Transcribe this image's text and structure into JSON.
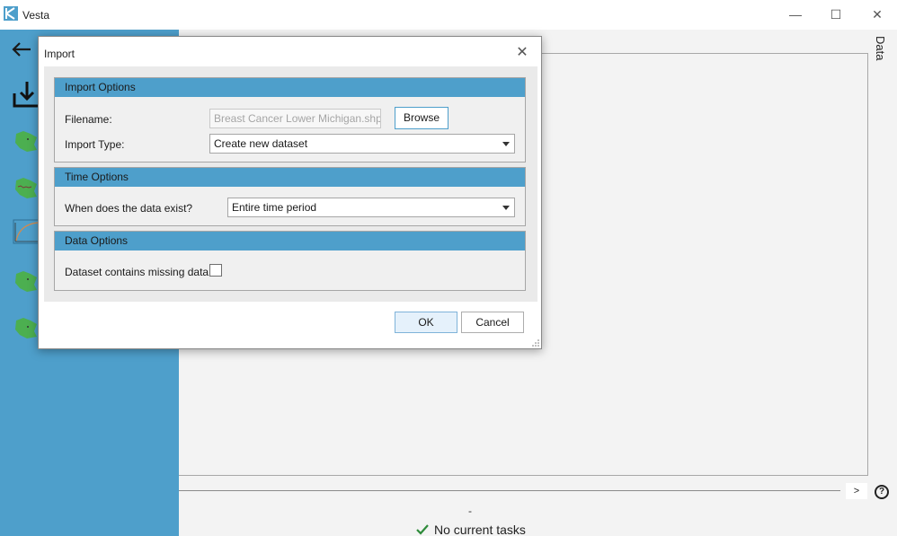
{
  "window": {
    "title": "Vesta",
    "icon": "vesta-logo-icon",
    "controls": {
      "minimize": "—",
      "maximize": "☐",
      "close": "✕"
    }
  },
  "sidebar": {
    "back_icon": "back-arrow-icon",
    "import_icon": "import-download-icon",
    "items": [
      {
        "icon": "map-thumbnail-icon"
      },
      {
        "icon": "map-thumbnail-icon"
      },
      {
        "icon": "chart-thumbnail-icon"
      },
      {
        "icon": "map-thumbnail-icon"
      },
      {
        "icon": "map-thumbnail-icon"
      }
    ]
  },
  "main": {
    "side_tab_label": "Data",
    "expand_label": ">",
    "help_label": "?",
    "status_dash": "-",
    "status_text": "No current tasks"
  },
  "dialog": {
    "title": "Import",
    "close_label": "✕",
    "import_options": {
      "heading": "Import Options",
      "filename_label": "Filename:",
      "filename_placeholder": "Breast Cancer Lower Michigan.shp",
      "browse_label": "Browse",
      "import_type_label": "Import Type:",
      "import_type_value": "Create new dataset"
    },
    "time_options": {
      "heading": "Time Options",
      "exist_label": "When does the data exist?",
      "exist_value": "Entire time period"
    },
    "data_options": {
      "heading": "Data Options",
      "missing_label": "Dataset contains missing data",
      "missing_checked": false
    },
    "ok_label": "OK",
    "cancel_label": "Cancel"
  },
  "colors": {
    "accent": "#4e9fcb",
    "map_green": "#4caf50",
    "check_green": "#2e8b3a"
  }
}
